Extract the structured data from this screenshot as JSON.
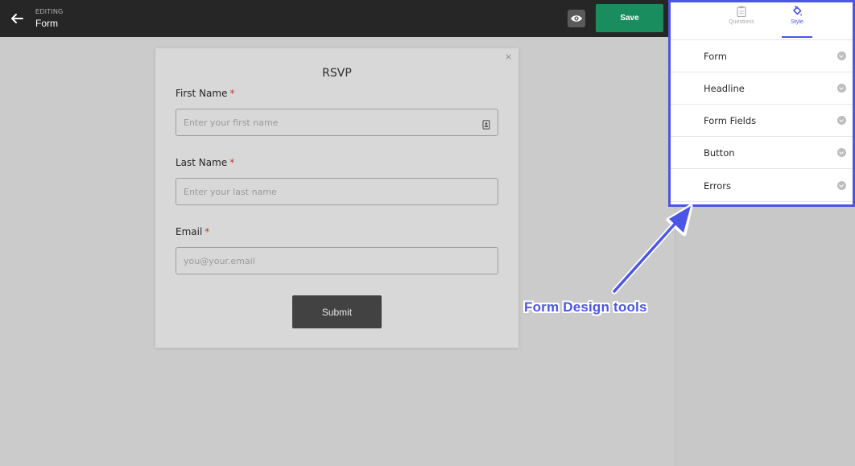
{
  "header": {
    "editing_label": "EDITING",
    "title": "Form",
    "save_label": "Save"
  },
  "form": {
    "heading": "RSVP",
    "fields": [
      {
        "label": "First Name",
        "required_mark": "*",
        "placeholder": "Enter your first name"
      },
      {
        "label": "Last Name",
        "required_mark": "*",
        "placeholder": "Enter your last name"
      },
      {
        "label": "Email",
        "required_mark": "*",
        "placeholder": "you@your.email"
      }
    ],
    "submit_label": "Submit",
    "close_glyph": "×"
  },
  "panel": {
    "tabs": [
      {
        "label": "Questions",
        "icon": "clipboard-icon",
        "active": false
      },
      {
        "label": "Style",
        "icon": "paint-bucket-icon",
        "active": true
      }
    ],
    "items": [
      {
        "label": "Form"
      },
      {
        "label": "Headline"
      },
      {
        "label": "Form Fields"
      },
      {
        "label": "Button"
      },
      {
        "label": "Errors"
      }
    ]
  },
  "annotation": {
    "text": "Form Design tools",
    "color": "#4b56e6"
  },
  "colors": {
    "accent": "#4b56e6",
    "save": "#1a8d5f",
    "topbar": "#262626"
  }
}
